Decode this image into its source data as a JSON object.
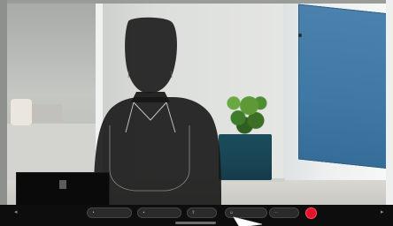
{
  "scene": {
    "panel_text": "",
    "self_preview_text": ""
  },
  "controls": [
    {
      "name": "control-1",
      "icon": "mic-icon",
      "label": ""
    },
    {
      "name": "control-2",
      "icon": "camera-icon",
      "label": ""
    },
    {
      "name": "control-3",
      "icon": "share-icon",
      "label": ""
    },
    {
      "name": "control-4",
      "icon": "reaction-icon",
      "label": ""
    },
    {
      "name": "control-5",
      "icon": "more-icon",
      "label": ""
    }
  ],
  "colors": {
    "end_call": "#e0142a",
    "panel_blue": "#3f78a4"
  }
}
